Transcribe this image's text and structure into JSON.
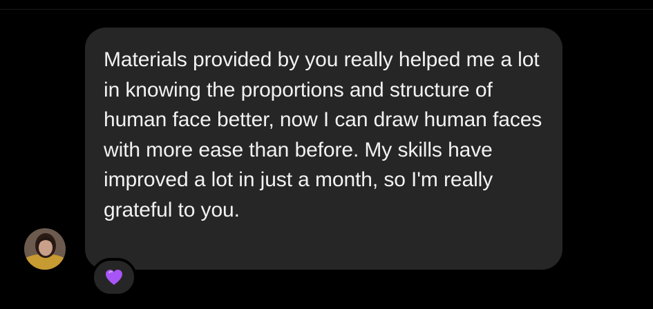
{
  "message": {
    "text": "Materials provided by you really helped me a lot in knowing the proportions and structure of human face better, now I can draw human faces with more ease than before. My skills have improved a lot in just a month, so I'm really grateful to you."
  },
  "avatar": {
    "icon": "profile-photo"
  },
  "reaction": {
    "icon": "purple-heart-icon",
    "color": "#a855f7"
  },
  "colors": {
    "background": "#000000",
    "bubble": "#262626",
    "text": "#f2f2f2"
  }
}
